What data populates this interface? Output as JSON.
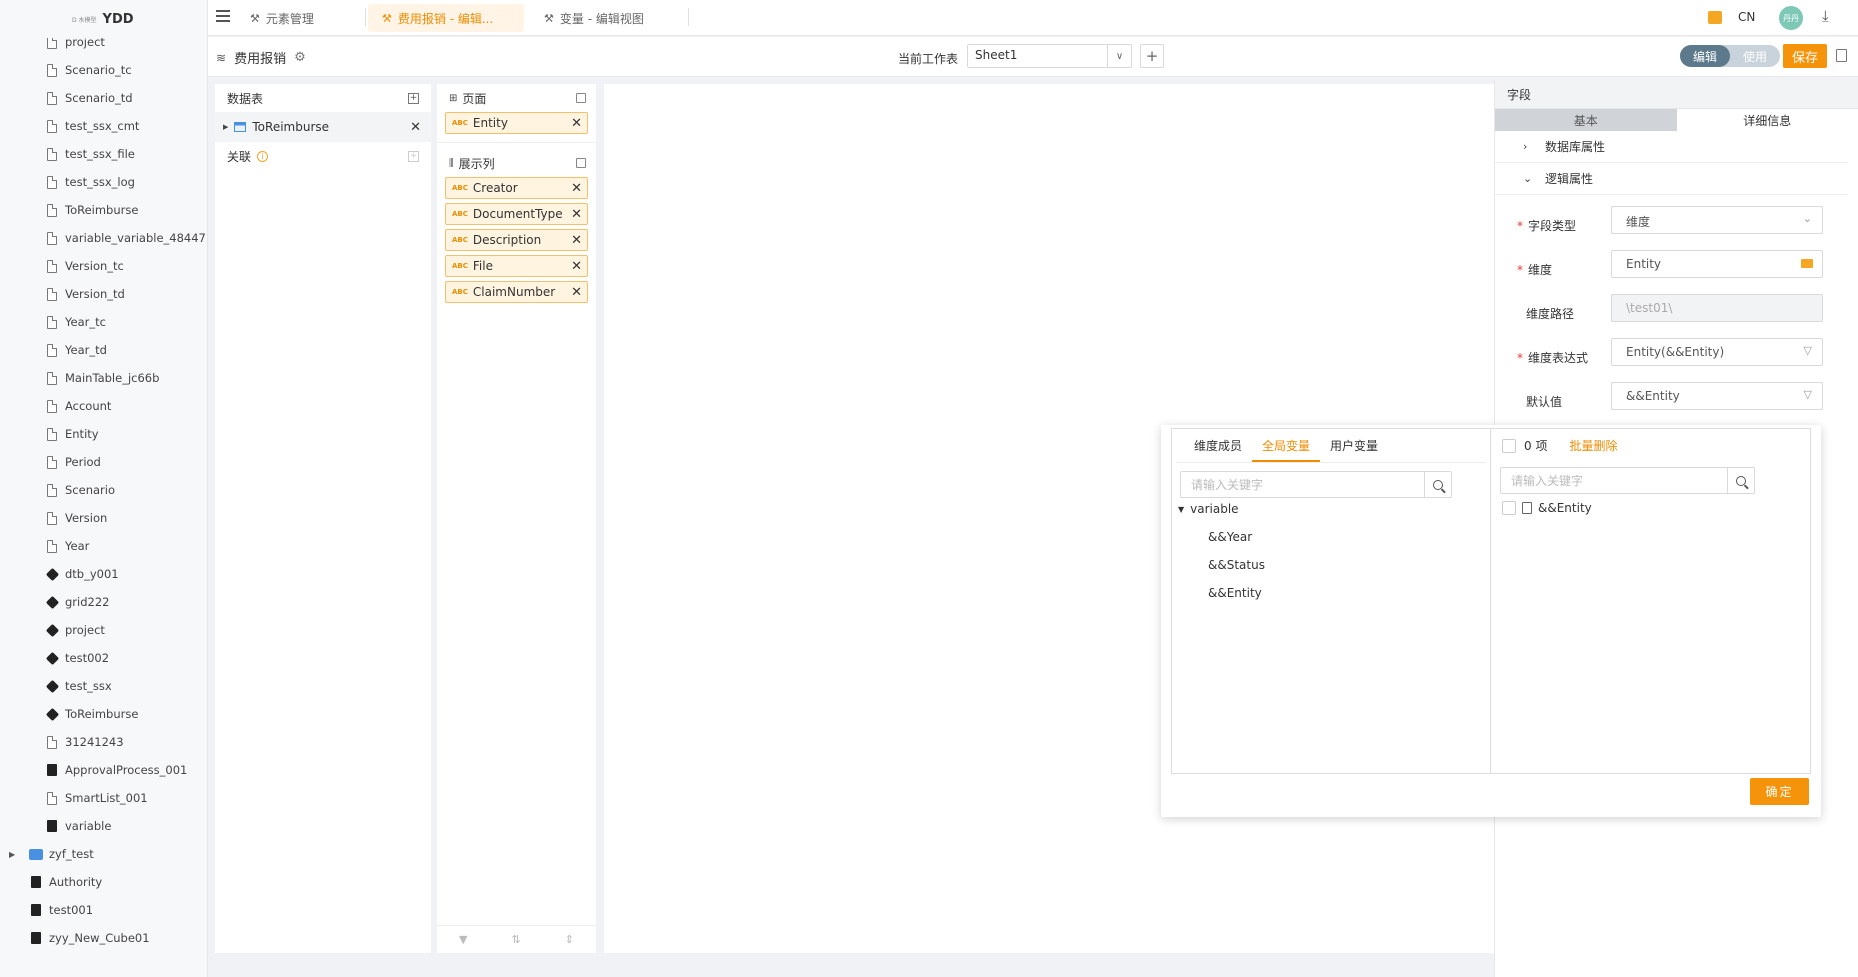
{
  "app": {
    "logo_small": "D 水模型",
    "logo_text": "YDD",
    "lang": "CN",
    "avatar_text": "丹丹"
  },
  "tabs": [
    {
      "label": "元素管理",
      "active": false
    },
    {
      "label": "费用报销 - 编辑...",
      "active": true
    },
    {
      "label": "变量 - 编辑视图",
      "active": false
    }
  ],
  "sidebar": {
    "items": [
      {
        "label": "project",
        "icon": "doc-icon",
        "level": 2
      },
      {
        "label": "Scenario_tc",
        "icon": "doc-icon",
        "level": 2
      },
      {
        "label": "Scenario_td",
        "icon": "doc-icon",
        "level": 2
      },
      {
        "label": "test_ssx_cmt",
        "icon": "doc-icon",
        "level": 2
      },
      {
        "label": "test_ssx_file",
        "icon": "doc-icon",
        "level": 2
      },
      {
        "label": "test_ssx_log",
        "icon": "doc-icon",
        "level": 2
      },
      {
        "label": "ToReimburse",
        "icon": "doc-icon",
        "level": 2
      },
      {
        "label": "variable_variable_48447",
        "icon": "doc-icon",
        "level": 2
      },
      {
        "label": "Version_tc",
        "icon": "doc-icon",
        "level": 2
      },
      {
        "label": "Version_td",
        "icon": "doc-icon",
        "level": 2
      },
      {
        "label": "Year_tc",
        "icon": "doc-icon",
        "level": 2
      },
      {
        "label": "Year_td",
        "icon": "doc-icon",
        "level": 2
      },
      {
        "label": "MainTable_jc66b",
        "icon": "doc-icon",
        "level": 2
      },
      {
        "label": "Account",
        "icon": "doc-icon",
        "level": 2
      },
      {
        "label": "Entity",
        "icon": "doc-icon",
        "level": 2
      },
      {
        "label": "Period",
        "icon": "doc-icon",
        "level": 2
      },
      {
        "label": "Scenario",
        "icon": "doc-icon",
        "level": 2
      },
      {
        "label": "Version",
        "icon": "doc-icon",
        "level": 2
      },
      {
        "label": "Year",
        "icon": "doc-icon",
        "level": 2
      },
      {
        "label": "dtb_y001",
        "icon": "cube-icon",
        "level": 2
      },
      {
        "label": "grid222",
        "icon": "cube-icon",
        "level": 2
      },
      {
        "label": "project",
        "icon": "cube-icon",
        "level": 2
      },
      {
        "label": "test002",
        "icon": "cube-icon",
        "level": 2
      },
      {
        "label": "test_ssx",
        "icon": "cube-icon",
        "level": 2
      },
      {
        "label": "ToReimburse",
        "icon": "cube-icon",
        "level": 2
      },
      {
        "label": "31241243",
        "icon": "doc-icon",
        "level": 2
      },
      {
        "label": "ApprovalProcess_001",
        "icon": "process-doc-icon",
        "level": 2
      },
      {
        "label": "SmartList_001",
        "icon": "doc-icon",
        "level": 2
      },
      {
        "label": "variable",
        "icon": "variable-icon",
        "level": 2
      },
      {
        "label": "zyf_test",
        "icon": "folder-icon",
        "level": 1
      },
      {
        "label": "Authority",
        "icon": "authority-doc-icon",
        "level": 1
      },
      {
        "label": "test001",
        "icon": "authority-doc-icon",
        "level": 1
      },
      {
        "label": "zyy_New_Cube01",
        "icon": "cube-tree-icon",
        "level": 1
      }
    ]
  },
  "toolbar": {
    "doc_title": "费用报销",
    "sheet_label": "当前工作表",
    "sheet_value": "Sheet1",
    "mode_edit": "编辑",
    "mode_use": "使用",
    "save_label": "保存"
  },
  "data_panel": {
    "title": "数据表",
    "table_name": "ToReimburse",
    "assoc_label": "关联"
  },
  "field_panel": {
    "page_title": "页面",
    "page_fields": [
      "Entity"
    ],
    "display_title": "展示列",
    "display_fields": [
      "Creator",
      "DocumentType",
      "Description",
      "File",
      "ClaimNumber"
    ],
    "abc": "ABC"
  },
  "props": {
    "title": "字段",
    "tab_basic": "基本",
    "tab_detail": "详细信息",
    "db_attrs": "数据库属性",
    "logic_attrs": "逻辑属性",
    "field_type_label": "字段类型",
    "field_type_value": "维度",
    "dimension_label": "维度",
    "dimension_value": "Entity",
    "dim_path_label": "维度路径",
    "dim_path_value": "\\test01\\",
    "dim_expr_label": "维度表达式",
    "dim_expr_value": "Entity(&&Entity)",
    "default_label": "默认值",
    "default_value": "&&Entity"
  },
  "popup": {
    "tab_members": "维度成员",
    "tab_global": "全局变量",
    "tab_user": "用户变量",
    "search_placeholder": "请输入关键字",
    "group_name": "variable",
    "variables": [
      "&&Year",
      "&&Status",
      "&&Entity"
    ],
    "count_text": "0 项",
    "batch_delete": "批量删除",
    "selected_items": [
      "&&Entity"
    ],
    "ok_label": "确定"
  },
  "colors": {
    "accent": "#f5940a",
    "active_tab_bg": "#fff4e5",
    "chip_bg": "#fff4e0",
    "mode_on": "#5d7a8c"
  }
}
